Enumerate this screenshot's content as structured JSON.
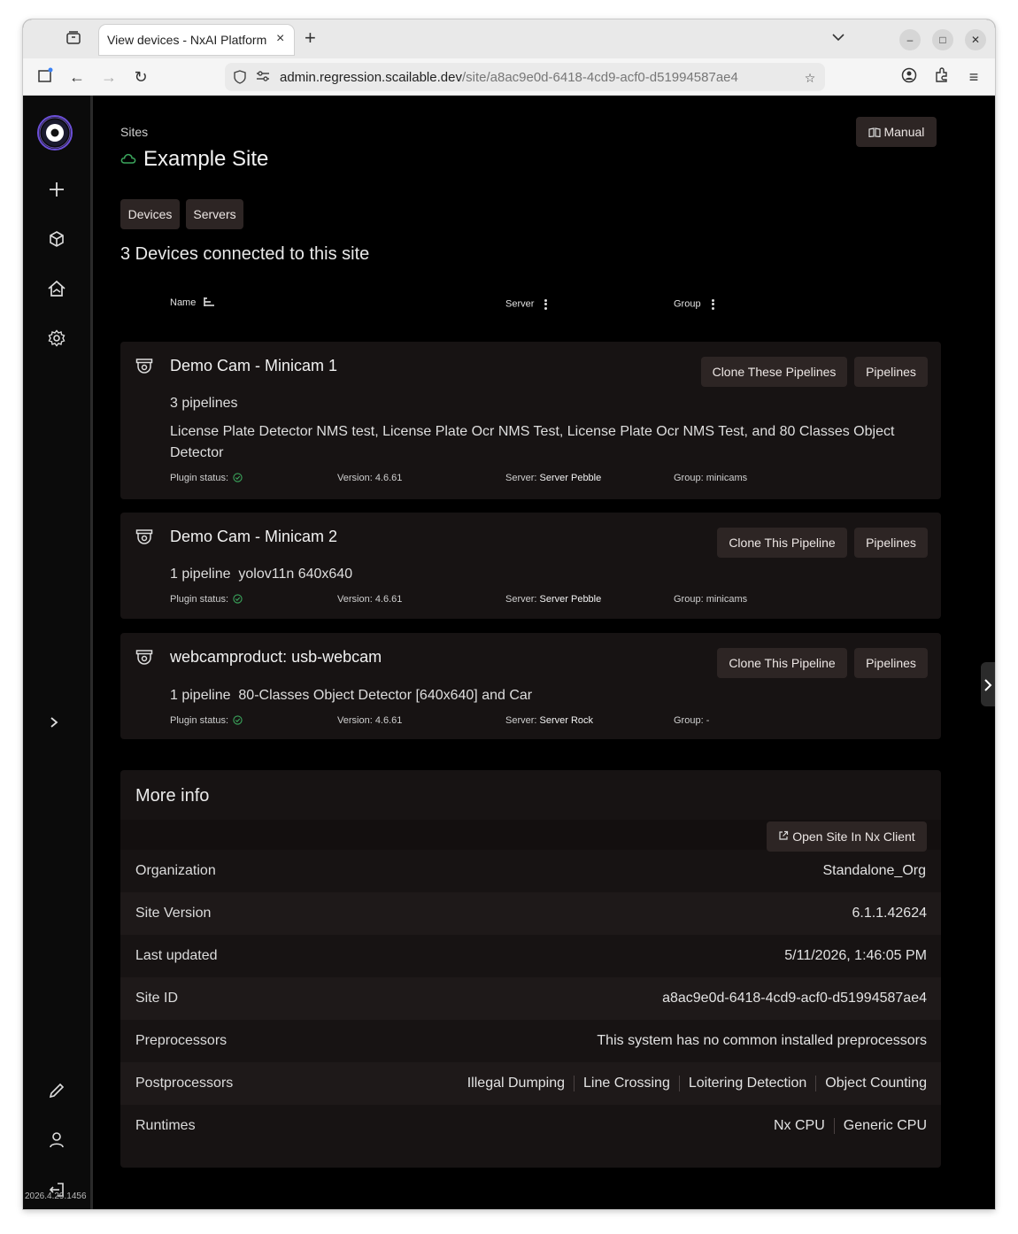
{
  "browser": {
    "tab_title": "View devices - NxAI Platform",
    "url_host": "admin.regression.scailable.dev",
    "url_path": "/site/a8ac9e0d-6418-4cd9-acf0-d51994587ae4"
  },
  "sidebar": {
    "version": "2026.4.29.1456"
  },
  "header": {
    "breadcrumb": "Sites",
    "site_title": "Example Site",
    "manual_label": "Manual"
  },
  "tabs": {
    "devices": "Devices",
    "servers": "Servers"
  },
  "devices_heading": "3 Devices connected to this site",
  "columns": {
    "name": "Name",
    "server": "Server",
    "group": "Group"
  },
  "labels": {
    "plugin_status": "Plugin status:",
    "version": "Version:",
    "server": "Server:",
    "group": "Group:",
    "pipelines_button": "Pipelines"
  },
  "devices": [
    {
      "name": "Demo Cam - Minicam 1",
      "clone_label": "Clone These Pipelines",
      "pipeline_count": "3 pipelines",
      "pipelines": "License Plate Detector NMS test, License Plate Ocr NMS Test, License Plate Ocr NMS Test, and 80 Classes Object Detector",
      "version": "4.6.61",
      "server": "Server Pebble",
      "group": "minicams"
    },
    {
      "name": "Demo Cam - Minicam 2",
      "clone_label": "Clone This Pipeline",
      "pipeline_count": "1 pipeline",
      "pipelines": "yolov11n 640x640",
      "version": "4.6.61",
      "server": "Server Pebble",
      "group": "minicams"
    },
    {
      "name": "webcamproduct: usb-webcam",
      "clone_label": "Clone This Pipeline",
      "pipeline_count": "1 pipeline",
      "pipelines": "80-Classes Object Detector [640x640] and Car",
      "version": "4.6.61",
      "server": "Server Rock",
      "group": "-"
    }
  ],
  "more_info": {
    "title": "More info",
    "open_nx_label": "Open Site In Nx Client",
    "rows": [
      {
        "label": "Organization",
        "value": "Standalone_Org"
      },
      {
        "label": "Site Version",
        "value": "6.1.1.42624"
      },
      {
        "label": "Last updated",
        "value": "5/11/2026, 1:46:05 PM"
      },
      {
        "label": "Site ID",
        "value": "a8ac9e0d-6418-4cd9-acf0-d51994587ae4"
      },
      {
        "label": "Preprocessors",
        "value": "This system has no common installed preprocessors"
      },
      {
        "label": "Postprocessors",
        "chips": [
          "Illegal Dumping",
          "Line Crossing",
          "Loitering Detection",
          "Object Counting"
        ]
      },
      {
        "label": "Runtimes",
        "chips": [
          "Nx CPU",
          "Generic CPU"
        ]
      }
    ]
  },
  "colors": {
    "page_bg": "#000000",
    "card_bg": "#171313",
    "button_bg": "#2d2524",
    "status_ok": "#3ba55c",
    "logo_accent": "#6b4fd8"
  }
}
